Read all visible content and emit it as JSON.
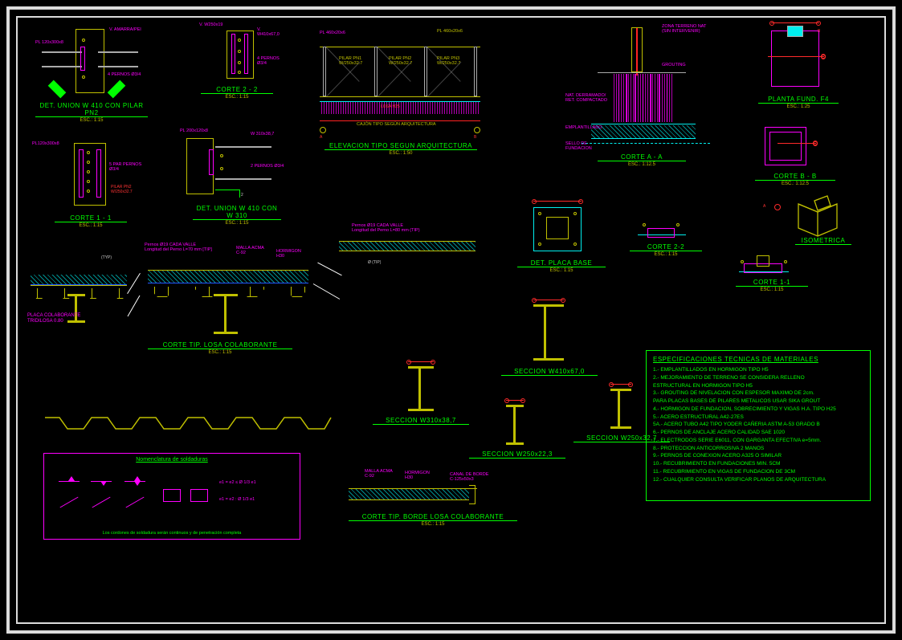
{
  "details": {
    "det_union_pn2": {
      "title": "DET. UNION W 410 CON PILAR PN2",
      "scale": "ESC.: 1:15"
    },
    "corte_2_2": {
      "title": "CORTE 2 - 2",
      "scale": "ESC.: 1:15"
    },
    "elev_arq": {
      "title": "ELEVACION TIPO SEGUN ARQUITECTURA",
      "scale": "ESC.: 1:50"
    },
    "corte_a_a": {
      "title": "CORTE A - A",
      "scale": "ESC.: 1:12.5"
    },
    "planta_fund": {
      "title": "PLANTA FUND. F4",
      "scale": "ESC.: 1:25"
    },
    "corte_1_1a": {
      "title": "CORTE 1 - 1",
      "scale": "ESC.: 1:15"
    },
    "det_union_310": {
      "title": "DET. UNION W 410 CON W 310",
      "scale": "ESC.: 1:15"
    },
    "det_placa_base": {
      "title": "DET. PLACA BASE",
      "scale": "ESC.: 1:15"
    },
    "corte_b_b": {
      "title": "CORTE B - B",
      "scale": "ESC.: 1:12.5"
    },
    "isometrica": {
      "title": "ISOMETRICA",
      "scale": ""
    },
    "corte_2_2b": {
      "title": "CORTE 2-2",
      "scale": "ESC.: 1:15"
    },
    "corte_1_1b": {
      "title": "CORTE 1-1",
      "scale": "ESC.: 1:15"
    },
    "corte_losa": {
      "title": "CORTE TIP. LOSA COLABORANTE",
      "scale": "ESC.: 1:15"
    },
    "sec_w410": {
      "title": "SECCION W410x67,0",
      "scale": ""
    },
    "sec_w310": {
      "title": "SECCION W310x38,7",
      "scale": ""
    },
    "sec_w250a": {
      "title": "SECCION W250x22,3",
      "scale": ""
    },
    "sec_w250b": {
      "title": "SECCION W250x32,7",
      "scale": ""
    },
    "corte_borde": {
      "title": "CORTE TIP. BORDE LOSA COLABORANTE",
      "scale": "ESC.: 1:15"
    }
  },
  "annotations": {
    "perno_valle_short": "Pernos Ø19 CADA VALLE",
    "perno_valle": "Pernos Ø19 CADA VALLE\nLongitud del Perno L=70 mm [TIP]",
    "perno_valle2": "Pernos Ø19 CADA VALLE\nLongitud del Perno L=80 mm (TIP)",
    "malla": "MALLA ACMA\nC-92",
    "hormigon": "HORMIGON\nH30",
    "placa_colab": "PLACA COLABORANTE\nTRIDILOSA 0.80",
    "canal_borde": "CANAL DE BORDE\nC-125x50x3",
    "pl_460": "PL 460x20x6",
    "v_amarra": "V. AMARRA/PEI",
    "grouting": "GROUTING",
    "nat_derramado": "NAT. DERRAMADO/\nRET. COMPACTADO",
    "emplantillado": "EMPLANTILLADO",
    "sello_fund": "SELLO DE\nFUNDACION",
    "zona_n_nat": "ZONA TERRENO NAT\n(SIN INTERVENIR)",
    "typ": "(TYP)",
    "tip": "(TIP)",
    "a_marker": "A",
    "b_marker": "B",
    "weld_ref": "e1 = e2 ≤ Ø 1/3 e1",
    "weld_ref2": "e1 = e2 : Ø 1/3 e1"
  },
  "weld_box": {
    "title": "Nomenclatura de soldaduras",
    "note": "Los cordones de soldadura serán continuos y de penetración completa"
  },
  "spec": {
    "title": "ESPECIFICACIONES TECNICAS DE MATERIALES",
    "items": [
      "1.- EMPLANTILLADOS EN HORMIGON TIPO H5",
      "2.- MEJORAMIENTO DE TERRENO SE CONSIDERA RELLENO",
      "    ESTRUCTURAL EN HORMIGON TIPO H5",
      "3.- GROUTING DE NIVELACION CON ESPESOR MAXIMO DE 2cm.",
      "    PARA PLACAS BASES DE PILARES METALICOS USAR SIKA GROUT",
      "4.- HORMIGON DE FUNDACION, SOBRECIMIENTO Y VIGAS H.A. TIPO H25",
      "5.- ACERO ESTRUCTURAL A42-27ES",
      "5A.- ACERO TUBO A42 TIPO YODER CAÑERIA ASTM A-53 GRADO B",
      "6.- PERNOS DE ANCLAJE ACERO CALIDAD SAE 1020",
      "7.- ELECTRODOS SERIE E6011, CON GARGANTA EFECTIVA e=5mm.",
      "8.- PROTECCION ANTICORROSIVA 2 MANOS",
      "9.- PERNOS DE CONEXION ACERO A325 O SIMILAR",
      "10.- RECUBRIMIENTO EN FUNDACIONES MIN. 5CM",
      "11.- RECUBRIMIENTO EN VIGAS DE FUNDACION DE 3CM",
      "12.- CUALQUIER CONSULTA VERIFICAR PLANOS DE ARQUITECTURA"
    ]
  }
}
